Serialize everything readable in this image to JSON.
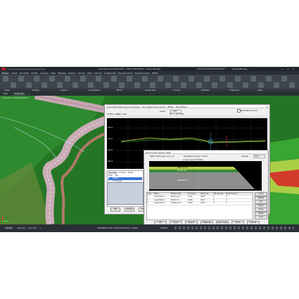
{
  "app": {
    "window_title": "Autodesk AutoCAD 2021 - SECTION RINALD - Road 6B.dwg",
    "search_placeholder": "Type a keyword or phrase",
    "user": "spmsteffanajs..."
  },
  "menu_tabs": [
    "Home",
    "Insert",
    "Annotate",
    "Modify",
    "Analyze",
    "View",
    "Manage",
    "Output",
    "Survey",
    "Help",
    "Add-ins",
    "Collaborate",
    "Express Tools",
    "Featured Apps",
    "INFRA"
  ],
  "ribbon_panels": [
    "Draw",
    "Modify",
    "Layers",
    "Annotation",
    "Block",
    "Properties",
    "Groups",
    "Utilities",
    "Clipboard",
    "View"
  ],
  "doc_tabs": {
    "start": "Start",
    "drawing": "Road 6B"
  },
  "viewport_label": "[-]Custom View][Realistic]",
  "profile_dialog": {
    "title": "Road 6B Profile Layout Window - 3D: [alignment-name] - INFRA - [RoadPlan]",
    "checkbox_label": "Bracketed Road",
    "scale_label": "Scale",
    "scale_value": "1:1000",
    "info": "Kb = 10:1000",
    "toolbar_label": "Profile view",
    "toolbar_value": "Top view",
    "elev_labels": [
      "200.0",
      "150.0",
      "100.0",
      "050.0"
    ],
    "sidebar_tabs": [
      "Pavement",
      "Combine",
      "Stable"
    ],
    "sidebar_tabs2": [
      "Type",
      "Tag"
    ],
    "sidebar_rows": [
      {
        "a": "1",
        "b": "Asphalt"
      },
      {
        "a": "2",
        "b": "Underlayer"
      }
    ],
    "buttons": [
      "OK",
      "Cancel",
      "Help"
    ]
  },
  "cross_dialog": {
    "title": "Road Cross Section Edit",
    "total_thickness_label": "Total Thickness (cm): 6",
    "road_level_label": "Road/bot Slope: 1.00%",
    "preset_label": "Preset:",
    "preset_value": "Right",
    "scale_caption": "Cross Level Profiles",
    "layer_labels": [
      "Wearing 6.1",
      "Binder 6.2",
      "Subbase 6.3"
    ],
    "columns": [
      "Layer",
      "Name",
      "Position Hint",
      "Thickness",
      "Hatch pat.",
      "Left Overlap",
      "Right Overlap"
    ],
    "rows": [
      {
        "layer": "1",
        "name": "Layer(Path)_1",
        "hint": "Wearing 6.1",
        "thick": "0.030",
        "hatch": "Hatch",
        "left": "0",
        "right": "0"
      },
      {
        "layer": "2",
        "name": "Layer(Path)_2",
        "hint": "Binder 6.2",
        "thick": "0.080",
        "hatch": "Hatch",
        "left": "0",
        "right": "0"
      },
      {
        "layer": "3",
        "name": "Layer(Path)_3",
        "hint": "Subbase 6.3",
        "thick": "0.300",
        "hatch": "Hatch",
        "left": "0",
        "right": "0"
      }
    ],
    "side_buttons": [
      "Insert",
      "Delete",
      "Up",
      "Down",
      "Copy",
      "Paste",
      "Info"
    ],
    "bottom_buttons": [
      "OK",
      "Insert",
      "Export",
      "Materials",
      "Clear Layer",
      "Print",
      "Cancel"
    ]
  },
  "status": {
    "model_tab": "Model",
    "layout_tabs": [
      "Layout1",
      "Layout2"
    ],
    "coords": "1899690.4058, 4971733.8620, 0.0000",
    "mode": "MODEL"
  },
  "colors": {
    "terrain": "#2a7a2a",
    "road": "#c7a8b3",
    "accent": "#b02027"
  }
}
